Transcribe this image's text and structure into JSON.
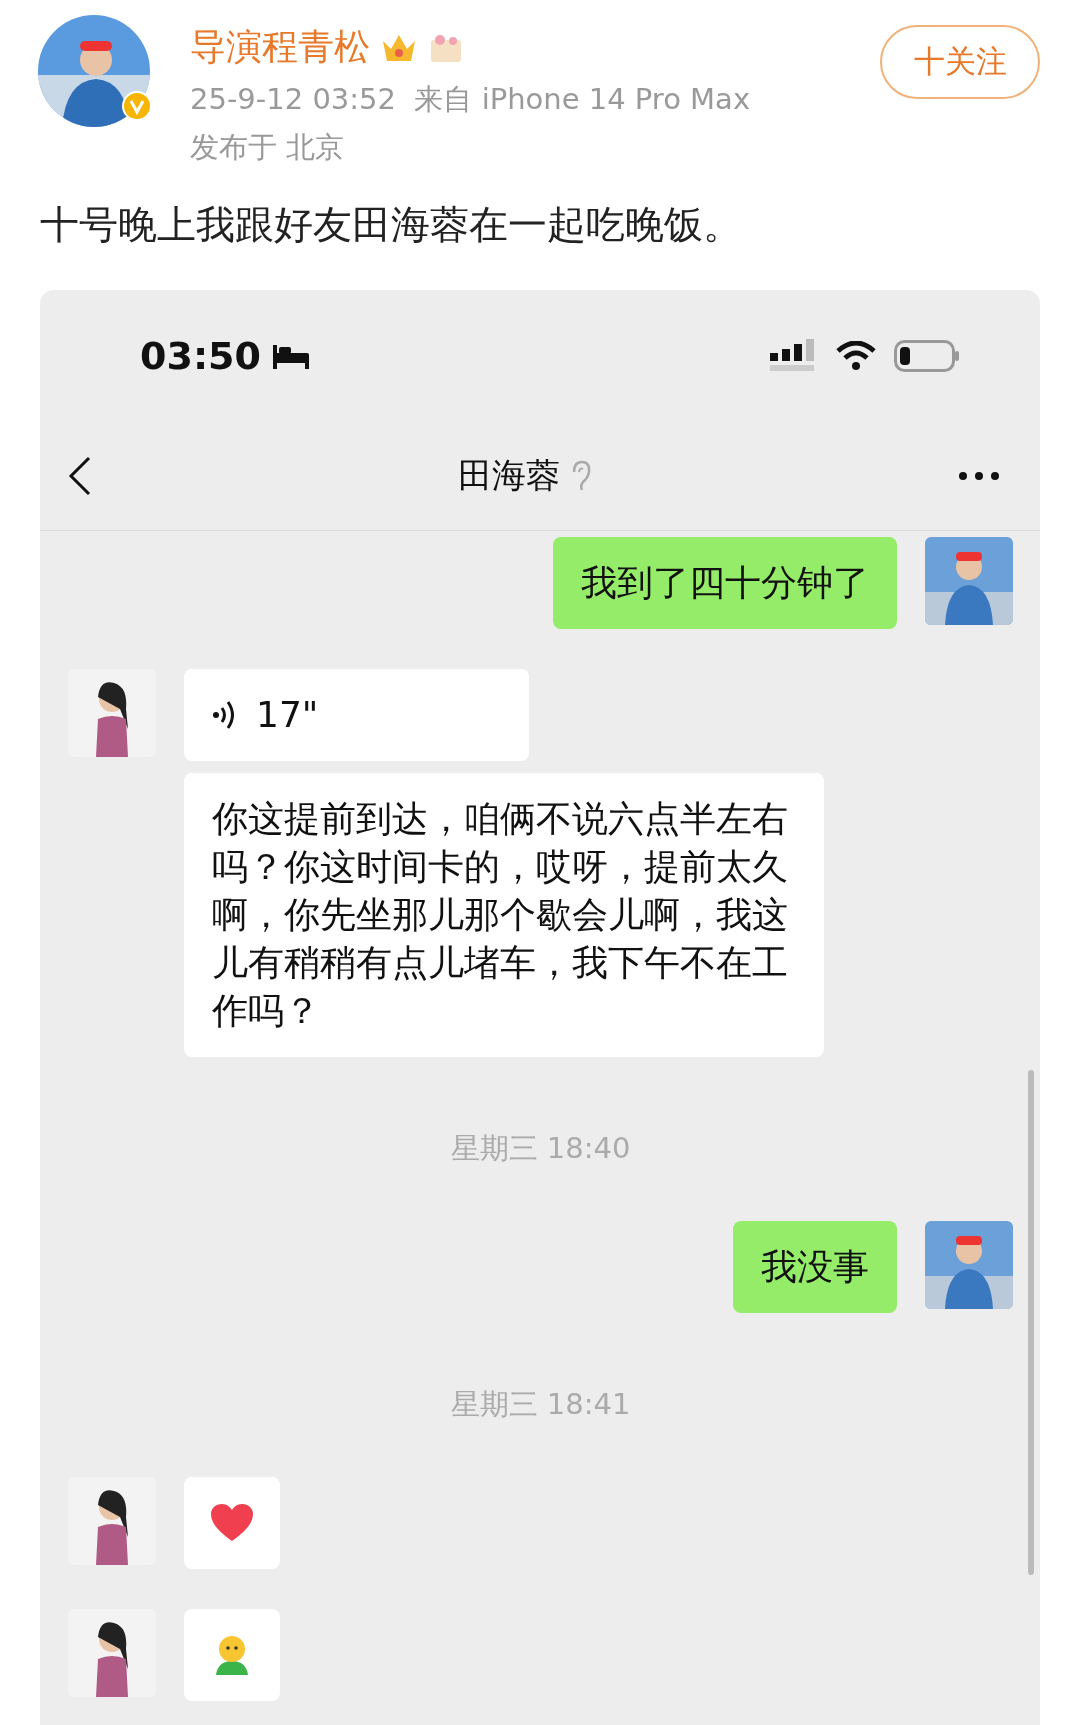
{
  "post": {
    "author": "导演程青松",
    "date": "25-9-12 03:52",
    "source": "来自 iPhone 14 Pro Max",
    "location": "发布于 北京",
    "follow_label": "十关注",
    "text": "十号晚上我跟好友田海蓉在一起吃晚饭。"
  },
  "chat": {
    "status_time": "03:50",
    "title": "田海蓉",
    "messages": [
      {
        "kind": "text",
        "outgoing": true,
        "avatar": true,
        "text": "我到了四十分钟了"
      },
      {
        "kind": "voice",
        "outgoing": false,
        "avatar": true,
        "text": "17\""
      },
      {
        "kind": "text",
        "outgoing": false,
        "avatar": false,
        "text": "你这提前到达，咱俩不说六点半左右吗？你这时间卡的，哎呀，提前太久啊，你先坐那儿那个歇会儿啊，我这儿有稍稍有点儿堵车，我下午不在工作吗？"
      },
      {
        "kind": "time",
        "text": "星期三 18:40"
      },
      {
        "kind": "text",
        "outgoing": true,
        "avatar": true,
        "text": "我没事"
      },
      {
        "kind": "time",
        "text": "星期三 18:41"
      },
      {
        "kind": "heart",
        "outgoing": false,
        "avatar": true
      },
      {
        "kind": "figure",
        "outgoing": false,
        "avatar": true
      }
    ]
  }
}
